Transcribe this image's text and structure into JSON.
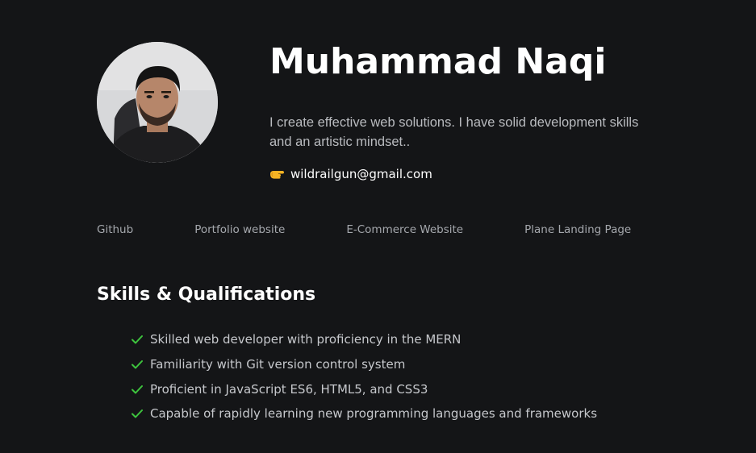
{
  "profile": {
    "name": "Muhammad Naqi",
    "bio": "I create effective web solutions. I have solid development skills and an artistic mindset..",
    "email_icon": "pointing-hand-icon",
    "email": "wildrailgun@gmail.com",
    "avatar": "profile-photo"
  },
  "links": [
    {
      "label": "Github"
    },
    {
      "label": "Portfolio website"
    },
    {
      "label": "E-Commerce Website"
    },
    {
      "label": "Plane Landing Page"
    }
  ],
  "skills": {
    "title": "Skills & Qualifications",
    "check_icon": "check-icon",
    "check_color": "#3ec43e",
    "items": [
      "Skilled web developer with proficiency in the MERN",
      "Familiarity with Git version control system",
      "Proficient in JavaScript ES6, HTML5, and CSS3",
      "Capable of rapidly learning new programming languages and frameworks"
    ]
  },
  "colors": {
    "background": "#141517",
    "heading": "#ffffff",
    "body_text": "#b9bbbf",
    "link_text": "#a5a8ad"
  }
}
